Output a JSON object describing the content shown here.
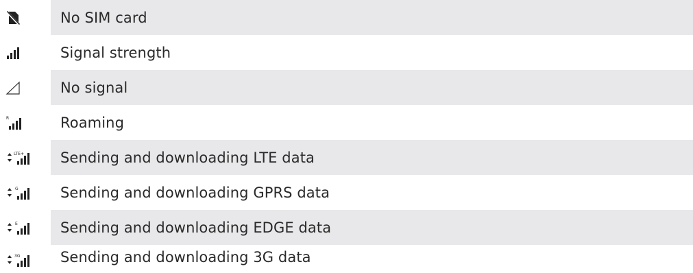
{
  "rows": [
    {
      "icon": "no-sim-card-icon",
      "label": "No SIM card",
      "shaded": true
    },
    {
      "icon": "signal-strength-icon",
      "label": "Signal strength",
      "shaded": false
    },
    {
      "icon": "no-signal-icon",
      "label": "No signal",
      "shaded": true
    },
    {
      "icon": "roaming-icon",
      "label": "Roaming",
      "shaded": false,
      "badge": "R"
    },
    {
      "icon": "lte-data-icon",
      "label": "Sending and downloading LTE data",
      "shaded": true,
      "badge": "LTE+"
    },
    {
      "icon": "gprs-data-icon",
      "label": "Sending and downloading GPRS data",
      "shaded": false,
      "badge": "G"
    },
    {
      "icon": "edge-data-icon",
      "label": "Sending and downloading EDGE data",
      "shaded": true,
      "badge": "E"
    },
    {
      "icon": "3g-data-icon",
      "label": "Sending and downloading 3G data",
      "shaded": false,
      "badge": "3G"
    }
  ],
  "colors": {
    "row_shade": "#e8e8ea",
    "text": "#2a2a2a",
    "icon": "#222222"
  }
}
